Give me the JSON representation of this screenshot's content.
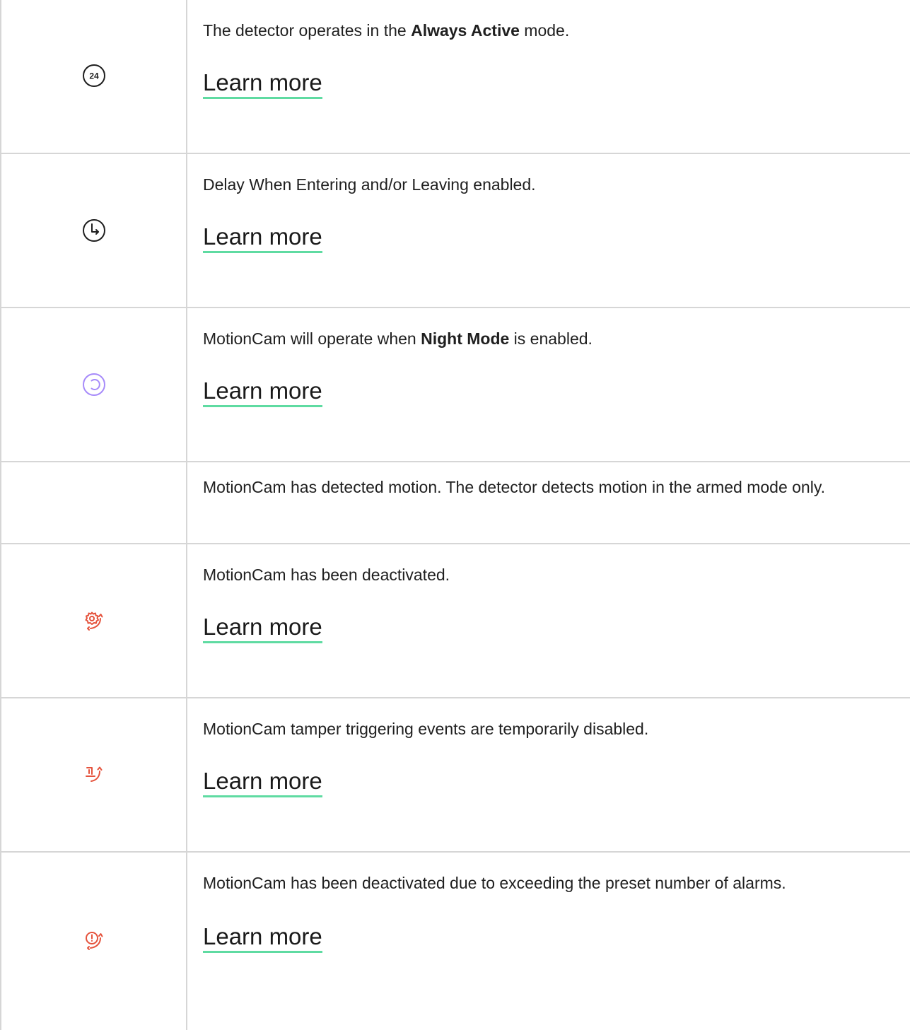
{
  "colors": {
    "border": "#d6d6d6",
    "link_underline": "#5fdba2",
    "night_mode_icon": "#a78bfa",
    "alert_icon": "#e5533d",
    "default_icon": "#1f1f1f"
  },
  "rows": [
    {
      "icon": "24-hour-icon",
      "icon_text": "24",
      "desc_before": "The detector operates in the ",
      "desc_bold": "Always Active",
      "desc_after": " mode.",
      "link": "Learn more"
    },
    {
      "icon": "clock-delay-icon",
      "desc_before": "Delay When Entering and/or Leaving enabled.",
      "desc_bold": "",
      "desc_after": "",
      "link": "Learn more"
    },
    {
      "icon": "night-mode-icon",
      "desc_before": "MotionCam will operate when ",
      "desc_bold": "Night Mode",
      "desc_after": " is enabled.",
      "link": "Learn more"
    },
    {
      "icon": "",
      "desc_before": "MotionCam has detected motion. The detector detects motion in the armed mode only.",
      "desc_bold": "",
      "desc_after": "",
      "link": ""
    },
    {
      "icon": "deactivated-gear-icon",
      "desc_before": "MotionCam has been deactivated.",
      "desc_bold": "",
      "desc_after": "",
      "link": "Learn more"
    },
    {
      "icon": "tamper-disabled-icon",
      "desc_before": "MotionCam tamper triggering events are temporarily disabled.",
      "desc_bold": "",
      "desc_after": "",
      "link": "Learn more"
    },
    {
      "icon": "alarm-limit-deactivated-icon",
      "desc_before": "MotionCam has been deactivated due to exceeding the preset number of alarms.",
      "desc_bold": "",
      "desc_after": "",
      "link": "Learn more"
    }
  ]
}
